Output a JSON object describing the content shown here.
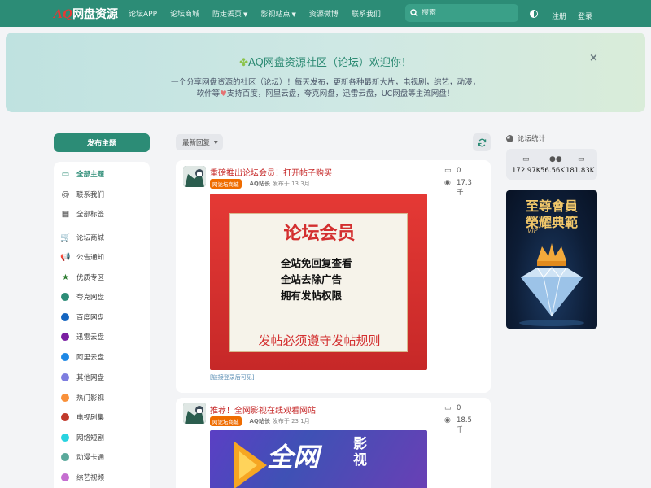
{
  "header": {
    "logo_prefix": "AQ",
    "logo_text": "网盘资源",
    "nav": [
      {
        "label": "论坛APP",
        "dropdown": false
      },
      {
        "label": "论坛商城",
        "dropdown": false
      },
      {
        "label": "防走丢页",
        "dropdown": true
      },
      {
        "label": "影视站点",
        "dropdown": true
      },
      {
        "label": "资源微博",
        "dropdown": false
      },
      {
        "label": "联系我们",
        "dropdown": false
      }
    ],
    "search_placeholder": "搜索",
    "register": "注册",
    "login": "登录"
  },
  "banner": {
    "title": "AQ网盘资源社区（论坛）欢迎你！",
    "line1": "一个分享网盘资源的社区（论坛）！每天发布，更新各种最新大片，电视剧，综艺，动漫，",
    "line2_a": "软件等",
    "line2_b": "支持百度，阿里云盘，夸克网盘，迅雷云盘，UC网盘等主流网盘！",
    "close": "×"
  },
  "sidebar": {
    "post_button": "发布主题",
    "items": [
      {
        "label": "全部主题",
        "icon": "comments-icon",
        "active": true
      },
      {
        "label": "联系我们",
        "icon": "at-icon"
      },
      {
        "label": "全部标签",
        "icon": "grid-icon"
      },
      {
        "label": "论坛商城",
        "icon": "cart-icon",
        "color": "#f57c00"
      },
      {
        "label": "公告通知",
        "icon": "megaphone-icon",
        "color": "#d32f2f"
      },
      {
        "label": "优质专区",
        "icon": "star-icon",
        "color": "#2e7d32"
      },
      {
        "label": "夸克网盘",
        "color": "#2c8c76"
      },
      {
        "label": "百度网盘",
        "color": "#1565c0"
      },
      {
        "label": "迅雷云盘",
        "color": "#7b1fa2"
      },
      {
        "label": "阿里云盘",
        "color": "#1e88e5"
      },
      {
        "label": "其他网盘",
        "color": "#7e7ee0"
      },
      {
        "label": "热门影视",
        "color": "#f9913a"
      },
      {
        "label": "电视剧集",
        "color": "#c0392b"
      },
      {
        "label": "网络短剧",
        "color": "#29d3e0"
      },
      {
        "label": "动漫卡通",
        "color": "#5aa99b"
      },
      {
        "label": "综艺视频",
        "color": "#c56fd0"
      }
    ]
  },
  "toolbar": {
    "sort_label": "最新回复"
  },
  "posts": [
    {
      "title": "重磅推出论坛会员！打开帖子购买",
      "tag": "网论坛商城",
      "author": "AQ站长",
      "published": "发布于 13 3月",
      "comments": "0",
      "views": "17.3",
      "views_unit": "千",
      "image": {
        "heading": "论坛会员",
        "lines": [
          "全站免回复查看",
          "全站去除广告",
          "拥有发帖权限"
        ],
        "footer": "发帖必须遵守发帖规则"
      },
      "hidden_link": "[链接登录后可见]"
    },
    {
      "title": "推荐！全网影视在线观看网站",
      "tag": "网论坛商城",
      "author": "AQ站长",
      "published": "发布于 23 1月",
      "comments": "0",
      "views": "18.5",
      "views_unit": "千",
      "image": {
        "heading": "全网",
        "side1": "影",
        "side2": "视"
      }
    }
  ],
  "right": {
    "title": "论坛统计",
    "stats": [
      {
        "icon": "discussions-icon",
        "value": "172.97K"
      },
      {
        "icon": "users-icon",
        "value": "56.56K"
      },
      {
        "icon": "comments-icon",
        "value": "181.83K"
      }
    ],
    "ad": {
      "line1": "至尊會員",
      "line2": "榮耀典範",
      "vip": "VIP"
    }
  }
}
